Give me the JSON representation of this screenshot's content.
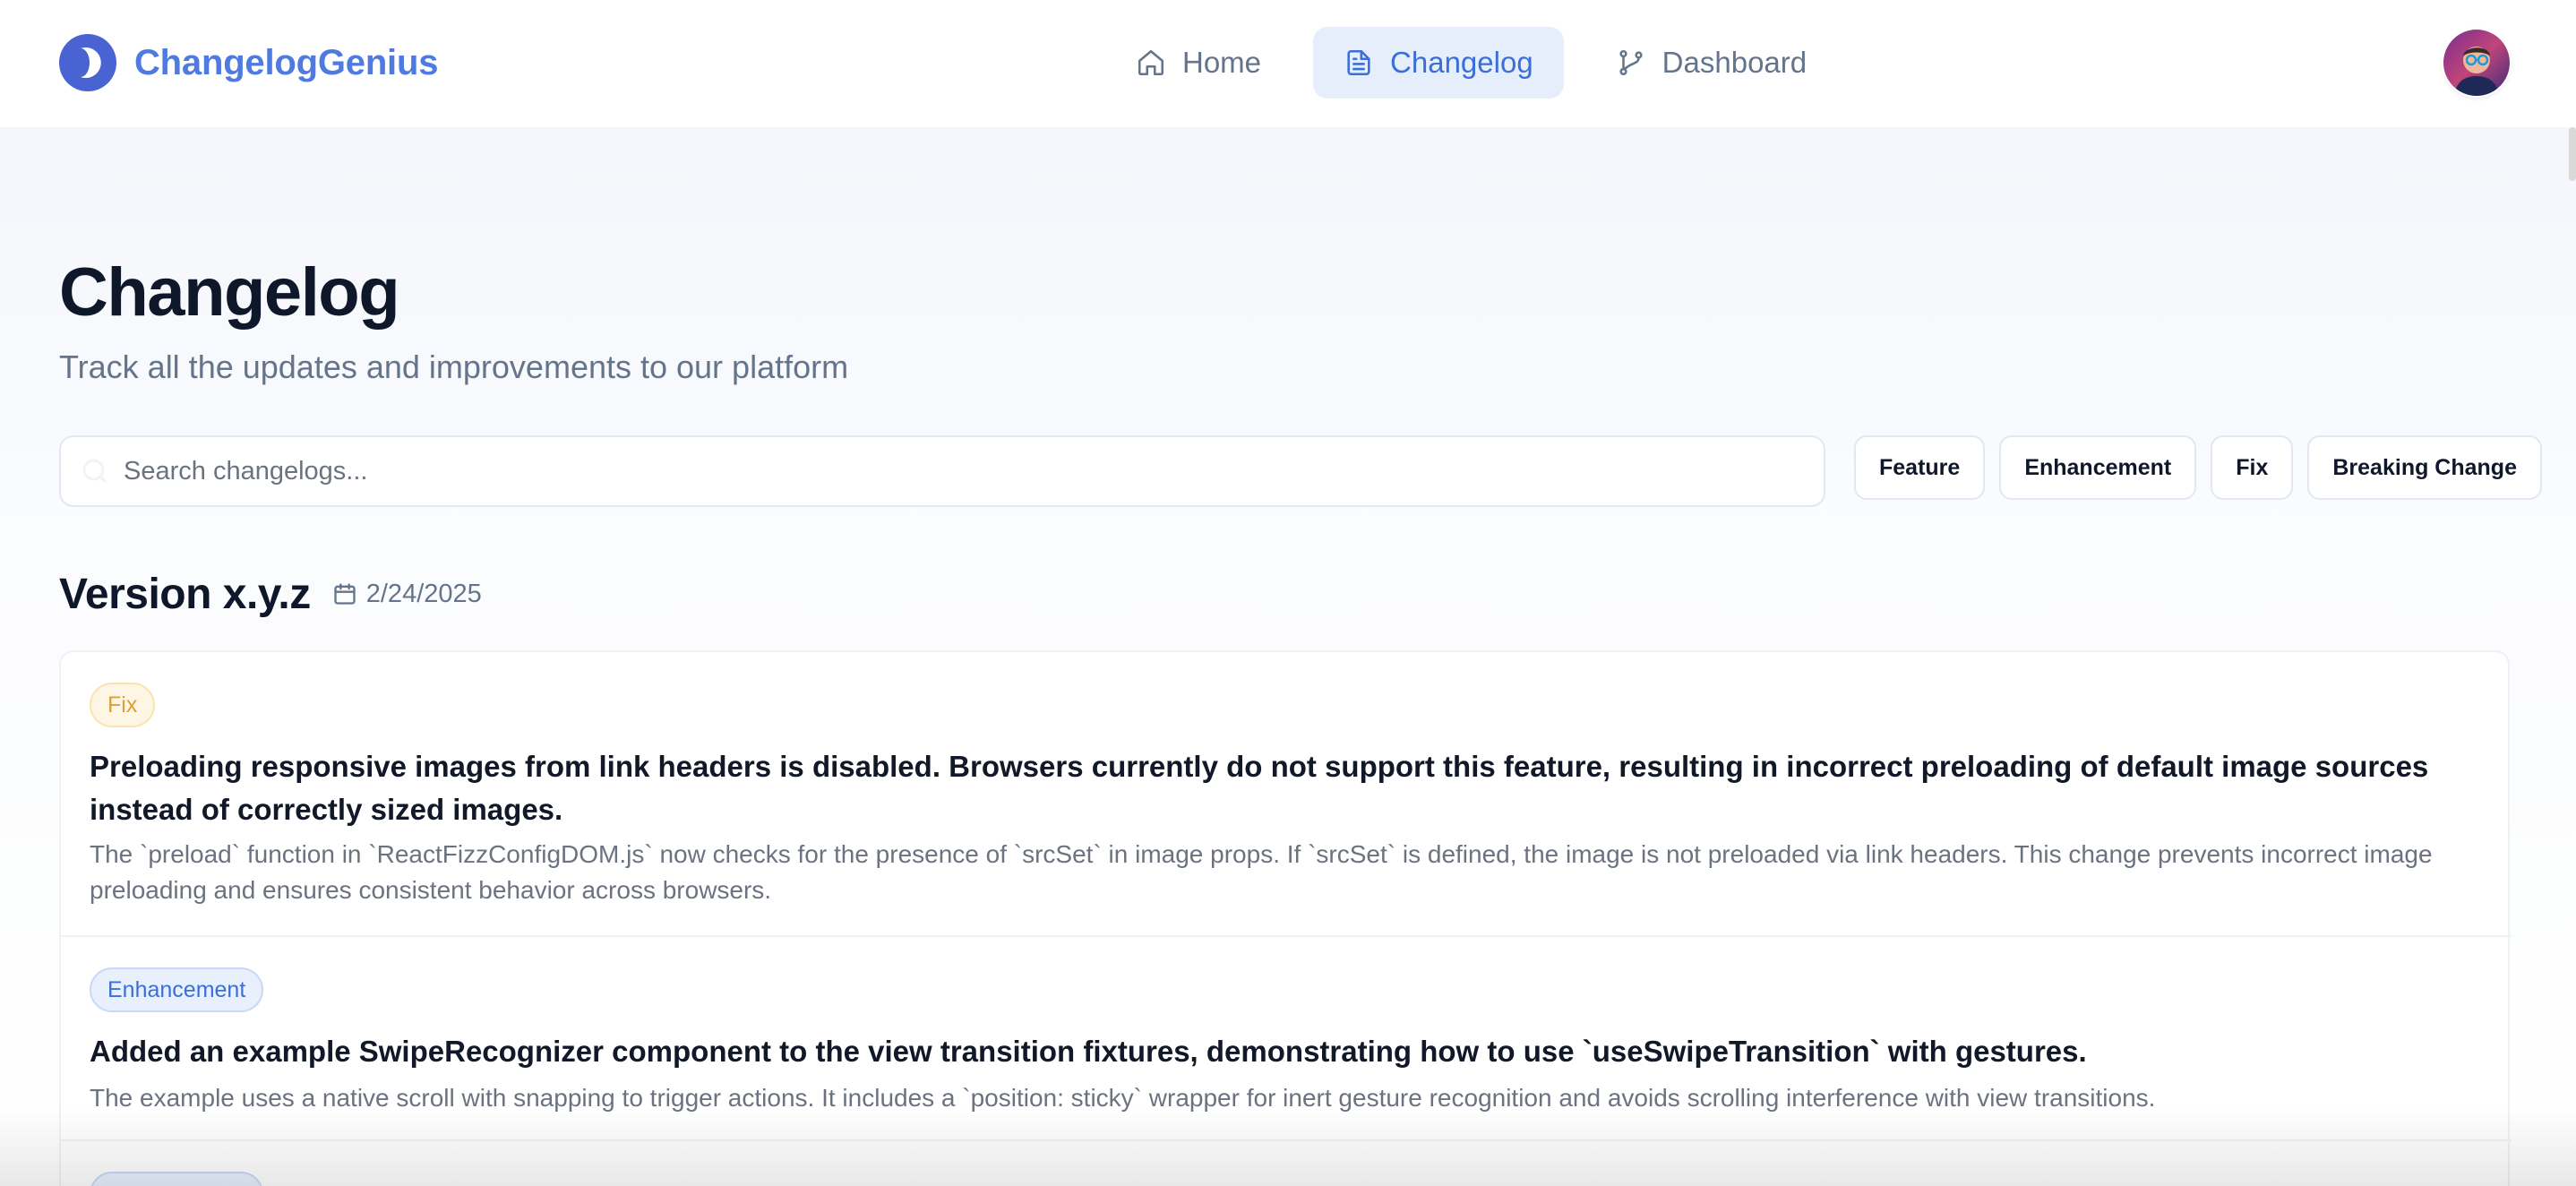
{
  "brand": {
    "name": "ChangelogGenius",
    "accent": "#4f7be0"
  },
  "nav": {
    "items": [
      {
        "label": "Home",
        "icon": "home-icon",
        "active": false
      },
      {
        "label": "Changelog",
        "icon": "file-text-icon",
        "active": true
      },
      {
        "label": "Dashboard",
        "icon": "git-branch-icon",
        "active": false
      }
    ]
  },
  "user": {
    "avatar": "user-avatar"
  },
  "header": {
    "title": "Changelog",
    "subtitle": "Track all the updates and improvements to our platform"
  },
  "search": {
    "placeholder": "Search changelogs...",
    "value": ""
  },
  "filters": [
    {
      "label": "Feature"
    },
    {
      "label": "Enhancement"
    },
    {
      "label": "Fix"
    },
    {
      "label": "Breaking Change"
    }
  ],
  "version": {
    "title": "Version x.y.z",
    "date": "2/24/2025",
    "entries": [
      {
        "type": "Fix",
        "type_color": "#d9a13a",
        "title": "Preloading responsive images from link headers is disabled. Browsers currently do not support this feature, resulting in incorrect preloading of default image sources instead of correctly sized images.",
        "description": "The `preload` function in `ReactFizzConfigDOM.js` now checks for the presence of `srcSet` in image props. If `srcSet` is defined, the image is not preloaded via link headers. This change prevents incorrect image preloading and ensures consistent behavior across browsers."
      },
      {
        "type": "Enhancement",
        "type_color": "#3b6fd8",
        "title": "Added an example SwipeRecognizer component to the view transition fixtures, demonstrating how to use `useSwipeTransition` with gestures.",
        "description": "The example uses a native scroll with snapping to trigger actions. It includes a `position: sticky` wrapper for inert gesture recognition and avoids scrolling interference with view transitions."
      }
    ]
  }
}
